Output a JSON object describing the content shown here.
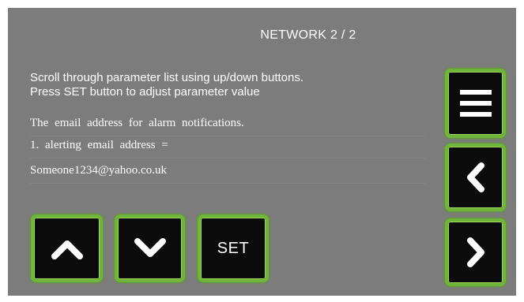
{
  "screen": {
    "title": "NETWORK 2 / 2",
    "instructions": [
      "Scroll through parameter list using up/down buttons.",
      "Press SET button to adjust parameter value"
    ],
    "parameter": {
      "description": "The email address for alarm notifications.",
      "label": "1. alerting email address =",
      "value": "Someone1234@yahoo.co.uk"
    }
  },
  "buttons": {
    "set_label": "SET",
    "up_icon": "chevron-up-icon",
    "down_icon": "chevron-down-icon",
    "menu_icon": "menu-icon",
    "back_icon": "chevron-left-icon",
    "forward_icon": "chevron-right-icon"
  },
  "colors": {
    "background": "#7c7c7c",
    "button_fill": "#0b0b0b",
    "button_border": "#6fb53a",
    "text": "#ffffff"
  }
}
